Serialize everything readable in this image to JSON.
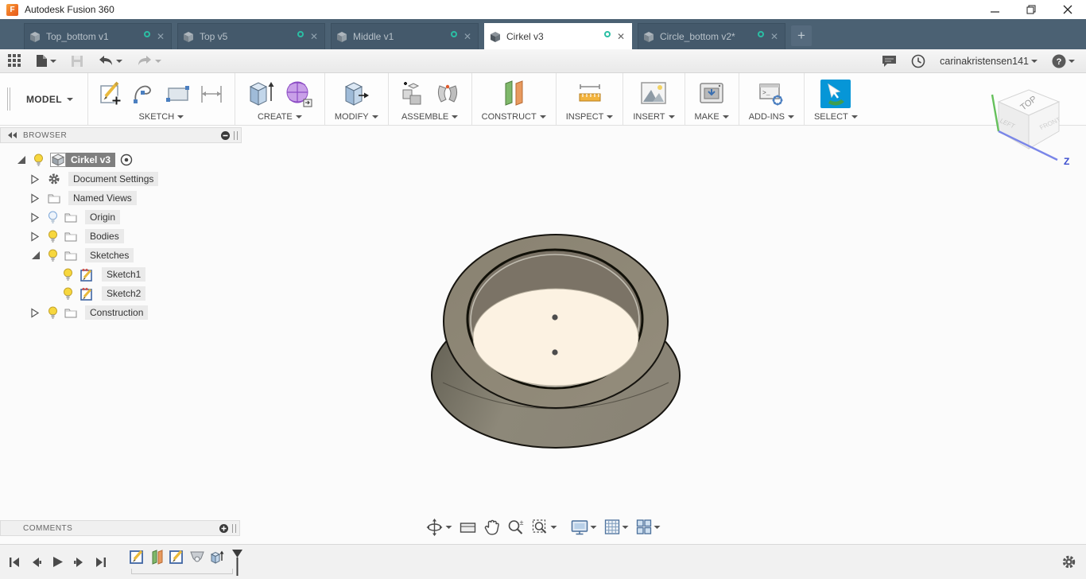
{
  "window": {
    "title": "Autodesk Fusion 360",
    "controls": {
      "minimize": "minimize",
      "restore": "restore",
      "close": "close"
    }
  },
  "tabs": {
    "items": [
      {
        "label": "Top_bottom v1",
        "active": false
      },
      {
        "label": "Top v5",
        "active": false
      },
      {
        "label": "Middle v1",
        "active": false
      },
      {
        "label": "Cirkel v3",
        "active": true
      },
      {
        "label": "Circle_bottom v2*",
        "active": false
      }
    ],
    "close_glyph": "✕",
    "new_tab_label": "+"
  },
  "toolbar": {
    "left_icons": [
      "app-grid-icon",
      "file-icon",
      "save-icon",
      "undo-icon",
      "redo-icon"
    ],
    "right_icons": [
      "comment-icon",
      "history-clock-icon",
      "user-menu",
      "help-icon"
    ],
    "user_name": "carinakristensen141",
    "help_label": "?"
  },
  "ribbon": {
    "workspace_label": "MODEL",
    "groups": [
      {
        "label": "SKETCH",
        "icons": [
          "create-sketch-icon",
          "spline-icon",
          "rectangle-icon",
          "sketch-dimension-icon"
        ]
      },
      {
        "label": "CREATE",
        "icons": [
          "extrude-icon",
          "create-form-icon"
        ]
      },
      {
        "label": "MODIFY",
        "icons": [
          "press-pull-icon"
        ]
      },
      {
        "label": "ASSEMBLE",
        "icons": [
          "new-component-icon",
          "joint-icon"
        ]
      },
      {
        "label": "CONSTRUCT",
        "icons": [
          "construction-plane-icon"
        ]
      },
      {
        "label": "INSPECT",
        "icons": [
          "measure-icon"
        ]
      },
      {
        "label": "INSERT",
        "icons": [
          "insert-image-icon"
        ]
      },
      {
        "label": "MAKE",
        "icons": [
          "3d-print-icon"
        ]
      },
      {
        "label": "ADD-INS",
        "icons": [
          "scripts-addins-icon"
        ]
      },
      {
        "label": "SELECT",
        "icons": [
          "select-icon"
        ]
      }
    ]
  },
  "browser": {
    "header": "BROWSER",
    "root_label": "Cirkel v3",
    "items": [
      {
        "label": "Document Settings",
        "icon": "gear-icon",
        "state": "collapsed"
      },
      {
        "label": "Named Views",
        "icon": "folder-icon",
        "state": "collapsed"
      },
      {
        "label": "Origin",
        "icon": "folder-icon",
        "bulb": "off",
        "state": "collapsed"
      },
      {
        "label": "Bodies",
        "icon": "folder-icon",
        "bulb": "on",
        "state": "collapsed"
      },
      {
        "label": "Sketches",
        "icon": "folder-icon",
        "bulb": "on",
        "state": "expanded"
      },
      {
        "label": "Sketch1",
        "icon": "sketch-icon",
        "bulb": "on"
      },
      {
        "label": "Sketch2",
        "icon": "sketch-icon",
        "bulb": "on"
      },
      {
        "label": "Construction",
        "icon": "folder-icon",
        "bulb": "on",
        "state": "collapsed"
      }
    ]
  },
  "comments": {
    "header": "COMMENTS"
  },
  "navbar": {
    "icons": [
      "orbit-icon",
      "look-at-icon",
      "pan-icon",
      "zoom-icon",
      "window-zoom-icon",
      "display-settings-icon",
      "layout-grid-icon",
      "viewports-icon"
    ]
  },
  "timeline": {
    "playback": [
      "go-to-start-icon",
      "step-back-icon",
      "play-icon",
      "step-forward-icon",
      "go-to-end-icon"
    ],
    "features": [
      "sketch-feature-icon",
      "construction-plane-feature-icon",
      "sketch-feature-icon",
      "fillet-feature-icon",
      "extrude-feature-icon"
    ],
    "marker": "timeline-position-marker",
    "settings": "gear-icon"
  },
  "viewcube": {
    "top": "TOP",
    "left": "LEFT",
    "front": "FRONT",
    "z_axis_label": "Z"
  },
  "colors": {
    "tabbar_bg": "#4b6173",
    "tab_bg": "#44596b",
    "active_tab_bg": "#ffffff",
    "status_green": "#2bbfa4",
    "select_highlight": "#0696d7",
    "model_rim": "#8e8777",
    "model_wall": "#7c7466",
    "model_floor": "#fcf2e2",
    "canvas_bg": "#fbfbfb"
  }
}
